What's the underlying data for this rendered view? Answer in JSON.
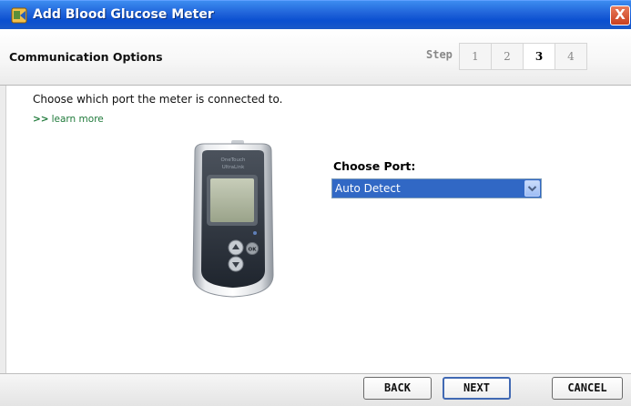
{
  "window": {
    "title": "Add Blood Glucose Meter",
    "close_label": "X"
  },
  "header": {
    "title": "Communication Options",
    "step_label": "Step",
    "steps": [
      "1",
      "2",
      "3",
      "4"
    ],
    "active_step": "3"
  },
  "content": {
    "instruction": "Choose which port the meter is connected to.",
    "learn_more_arrow": ">>",
    "learn_more": "learn more",
    "device_brand": "OneTouch",
    "device_model": "UltraLink",
    "device_ok_label": "OK",
    "port_label": "Choose Port:",
    "port_value": "Auto Detect"
  },
  "footer": {
    "back_label": "BACK",
    "next_label": "NEXT",
    "cancel_label": "CANCEL"
  },
  "colors": {
    "titlebar": "#1f62d9",
    "select_highlight": "#3168c5",
    "link": "#1f7a3a"
  }
}
